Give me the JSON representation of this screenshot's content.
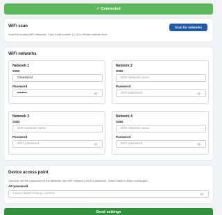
{
  "banner": {
    "text": "✓ Connected"
  },
  "scan": {
    "title": "WiFi scan",
    "description": "Scan for nearby WiFi networks. Click a slot number (1–4) to fill that network field.",
    "button_label": "Scan for networks"
  },
  "wifi": {
    "title": "WiFi networks",
    "networks": [
      {
        "title": "Network 1",
        "ssid_label": "SSID",
        "ssid_value": "GreenEnd",
        "ssid_placeholder": "WiFi network name",
        "password_label": "Password",
        "password_value": "••••••••",
        "password_placeholder": "WiFi password"
      },
      {
        "title": "Network 2",
        "ssid_label": "SSID",
        "ssid_value": "",
        "ssid_placeholder": "WiFi network name",
        "password_label": "Password",
        "password_value": "",
        "password_placeholder": "WiFi password"
      },
      {
        "title": "Network 3",
        "ssid_label": "SSID",
        "ssid_value": "",
        "ssid_placeholder": "WiFi network name",
        "password_label": "Password",
        "password_value": "",
        "password_placeholder": "WiFi password"
      },
      {
        "title": "Network 4",
        "ssid_label": "SSID",
        "ssid_value": "",
        "ssid_placeholder": "WiFi network name",
        "password_label": "Password",
        "password_value": "",
        "password_placeholder": "WiFi password"
      }
    ]
  },
  "ap": {
    "title": "Device access point",
    "description": "Optional: set the password for the altimeter own WiFi hotspot (min 8 characters). Leave blank to keep unchanged.",
    "password_label": "AP password",
    "password_placeholder": "Leave blank to keep current"
  },
  "send": {
    "label": "Send settings"
  },
  "colors": {
    "success": "#5cb85c",
    "primary": "#1f5ba8",
    "send": "#2f8f3a"
  },
  "icons": {
    "password_toggle": "eye-icon"
  }
}
